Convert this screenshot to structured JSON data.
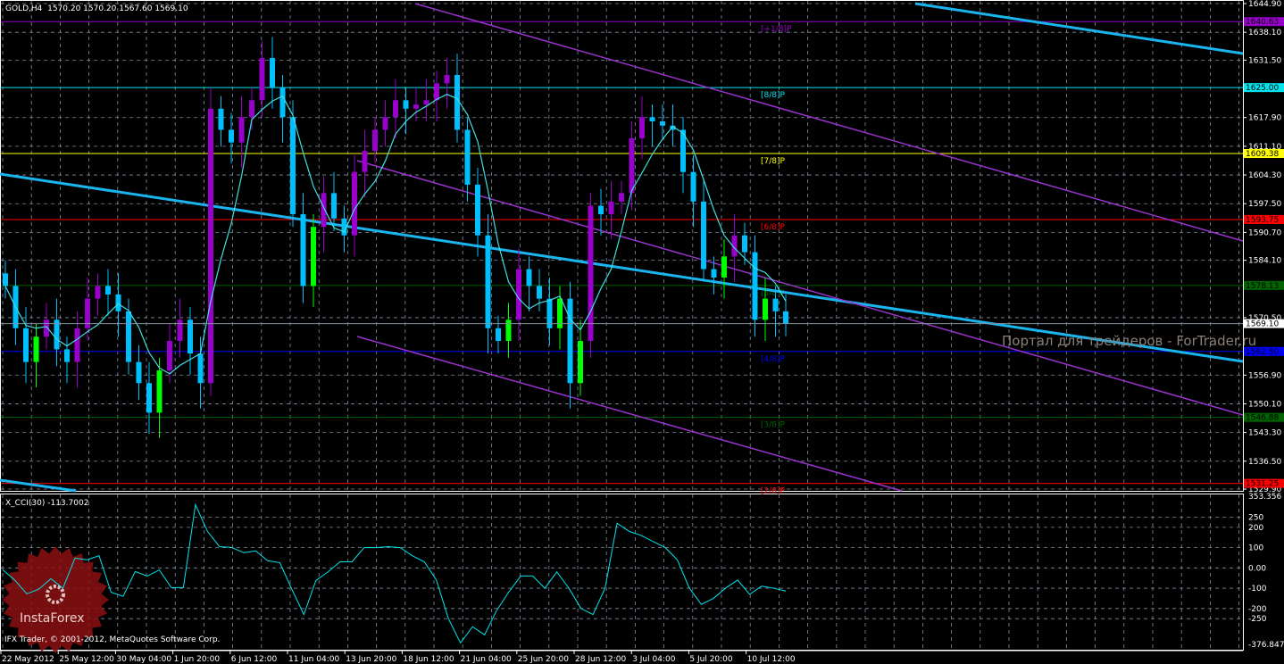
{
  "header": {
    "symbol": "GOLD,H4",
    "ohlc": "1570.20 1570.20 1567.60 1569.10"
  },
  "indicator": {
    "title": "X_CCI(30) -113.7002"
  },
  "copyright": "IFX Trader, © 2001-2012, MetaQuotes Software Corp.",
  "watermark": "Портал для трейдеров - ForTrader.ru",
  "logo": {
    "text": "InstaForex"
  },
  "colors": {
    "bg": "#000000",
    "grid": "#7f8ea0",
    "up": "#00ff00",
    "up_alt": "#9900cc",
    "down": "#00bfff",
    "ma": "#40e0e0",
    "trend": "#1ab4ee",
    "channel": "#9933cc",
    "cci": "#00e5ee"
  },
  "price_axis": {
    "max": 1644.9,
    "min": 1529.9,
    "ticks": [
      "1644.90",
      "1638.10",
      "1631.50",
      "1617.90",
      "1611.10",
      "1604.30",
      "1597.50",
      "1590.70",
      "1584.10",
      "1570.50",
      "1556.90",
      "1550.10",
      "1543.30",
      "1536.50",
      "1529.90"
    ]
  },
  "cci_axis": {
    "max": 353.356,
    "min": -376.847,
    "ticks": [
      "353.356",
      "250",
      "200",
      "100",
      "0.00",
      "-100",
      "-200",
      "-250",
      "-376.847"
    ]
  },
  "time_axis": [
    "22 May 2012",
    "25 May 12:00",
    "30 May 04:00",
    "1 Jun 20:00",
    "6 Jun 12:00",
    "11 Jun 04:00",
    "13 Jun 20:00",
    "18 Jun 12:00",
    "21 Jun 04:00",
    "25 Jun 20:00",
    "28 Jun 12:00",
    "3 Jul 04:00",
    "5 Jul 20:00",
    "10 Jul 12:00"
  ],
  "murrey_levels": [
    {
      "label": "[+1/8]P",
      "price": 1640.63,
      "text": "1640.63",
      "color": "#9900cc"
    },
    {
      "label": "[8/8]P",
      "price": 1625.0,
      "text": "1625.00",
      "color": "#00e5ee"
    },
    {
      "label": "[7/8]P",
      "price": 1609.38,
      "text": "1609.38",
      "color": "#ffff00"
    },
    {
      "label": "[6/8]P",
      "price": 1593.75,
      "text": "1593.75",
      "color": "#ff0000"
    },
    {
      "label": "[5/8]P",
      "price": 1578.13,
      "text": "1578.13",
      "color": "#006400"
    },
    {
      "label": "[4/8]P",
      "price": 1562.5,
      "text": "1562.50",
      "color": "#0000ff"
    },
    {
      "label": "[3/8]P",
      "price": 1546.88,
      "text": "1546.88",
      "color": "#006400"
    },
    {
      "label": "[2/8]P",
      "price": 1531.25,
      "text": "1531.25",
      "color": "#ff0000"
    }
  ],
  "bid": {
    "price": 1569.1,
    "text": "1569.10"
  },
  "chart_data": {
    "type": "candlestick",
    "closes": [
      1578,
      1568,
      1560,
      1566,
      1570,
      1563,
      1560,
      1568,
      1575,
      1578,
      1576,
      1572,
      1560,
      1555,
      1548,
      1558,
      1565,
      1570,
      1562,
      1555,
      1620,
      1615,
      1612,
      1618,
      1622,
      1632,
      1625,
      1618,
      1595,
      1578,
      1592,
      1600,
      1594,
      1590,
      1605,
      1610,
      1615,
      1618,
      1622,
      1620,
      1621,
      1622,
      1626,
      1628,
      1615,
      1602,
      1590,
      1568,
      1565,
      1570,
      1582,
      1578,
      1575,
      1568,
      1575,
      1555,
      1565,
      1597,
      1595,
      1598,
      1600,
      1613,
      1618,
      1617,
      1616,
      1615,
      1605,
      1598,
      1582,
      1580,
      1585,
      1590,
      1586,
      1570,
      1575,
      1572,
      1569.1
    ],
    "cci": [
      -9,
      -60,
      -128,
      -105,
      -53,
      -100,
      48,
      40,
      60,
      -120,
      -140,
      -18,
      -40,
      -10,
      -97,
      -97,
      312,
      180,
      105,
      101,
      75,
      84,
      35,
      26,
      -105,
      -230,
      -62,
      -20,
      30,
      30,
      100,
      100,
      105,
      100,
      60,
      30,
      -60,
      -250,
      -370,
      -290,
      -330,
      -210,
      -120,
      -40,
      -40,
      -100,
      -20,
      -100,
      -200,
      -230,
      -100,
      220,
      180,
      160,
      130,
      100,
      40,
      -100,
      -180,
      -150,
      -100,
      -60,
      -130,
      -90,
      -100,
      -114
    ]
  }
}
